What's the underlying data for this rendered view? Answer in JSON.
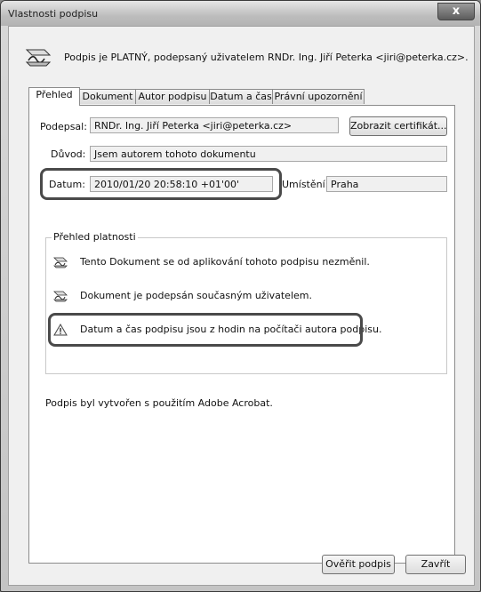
{
  "window": {
    "title": "Vlastnosti podpisu",
    "close_label": "x"
  },
  "header": {
    "text": "Podpis je PLATNÝ, podepsaný uživatelem RNDr. Ing. Jiří Peterka <jiri@peterka.cz>."
  },
  "tabs": [
    {
      "label": "Přehled"
    },
    {
      "label": "Dokument"
    },
    {
      "label": "Autor podpisu"
    },
    {
      "label": "Datum a čas"
    },
    {
      "label": "Právní upozornění"
    }
  ],
  "overview": {
    "signed_by_label": "Podepsal:",
    "signed_by_value": "RNDr. Ing. Jiří Peterka <jiri@peterka.cz>",
    "show_cert_button": "Zobrazit certifikát...",
    "reason_label": "Důvod:",
    "reason_value": "Jsem autorem tohoto dokumentu",
    "date_label": "Datum:",
    "date_value": "2010/01/20 20:58:10 +01'00'",
    "location_label": "Umístění:",
    "location_value": "Praha",
    "validity_title": "Přehled platnosti",
    "validity_items": [
      {
        "text": "Tento Dokument se od aplikování tohoto podpisu nezměnil.",
        "icon": "signature-pen-icon"
      },
      {
        "text": "Dokument je podepsán současným uživatelem.",
        "icon": "signature-pen-icon"
      },
      {
        "text": "Datum a čas podpisu jsou z hodin na počítači autora podpisu.",
        "icon": "warning-icon"
      }
    ],
    "footer": "Podpis byl vytvořen s použitím Adobe Acrobat."
  },
  "buttons": {
    "verify": "Ověřit podpis",
    "close": "Zavřít"
  }
}
